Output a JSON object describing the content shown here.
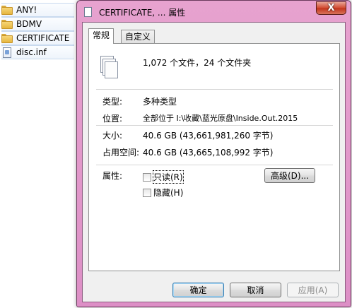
{
  "explorer": {
    "items": [
      {
        "name": "ANY!",
        "icon": "folder-icon"
      },
      {
        "name": "BDMV",
        "icon": "folder-icon"
      },
      {
        "name": "CERTIFICATE",
        "icon": "folder-icon"
      },
      {
        "name": "disc.inf",
        "icon": "document-icon"
      }
    ]
  },
  "dialog": {
    "title": "CERTIFICATE, ... 属性",
    "close_label": "X",
    "tabs": [
      {
        "label": "常规",
        "active": true
      },
      {
        "label": "自定义",
        "active": false
      }
    ],
    "summary": "1,072 个文件，24 个文件夹",
    "fields": {
      "type": {
        "label": "类型:",
        "value": "多种类型"
      },
      "location": {
        "label": "位置:",
        "value": "全部位于 I:\\收藏\\蓝光原盘\\Inside.Out.2015"
      },
      "size": {
        "label": "大小:",
        "value": "40.6 GB (43,661,981,260 字节)"
      },
      "size_on_disk": {
        "label": "占用空间:",
        "value": "40.6 GB (43,665,108,992 字节)"
      }
    },
    "attributes": {
      "label": "属性:",
      "readonly_label": "只读(R)",
      "readonly_checked": false,
      "hidden_label": "隐藏(H)",
      "hidden_checked": false,
      "advanced_button": "高级(D)..."
    },
    "buttons": {
      "ok": "确定",
      "cancel": "取消",
      "apply": "应用(A)"
    }
  },
  "colors": {
    "frame": "#e29acb",
    "close_button": "#c9412a",
    "default_button_border": "#3c7fb1"
  }
}
